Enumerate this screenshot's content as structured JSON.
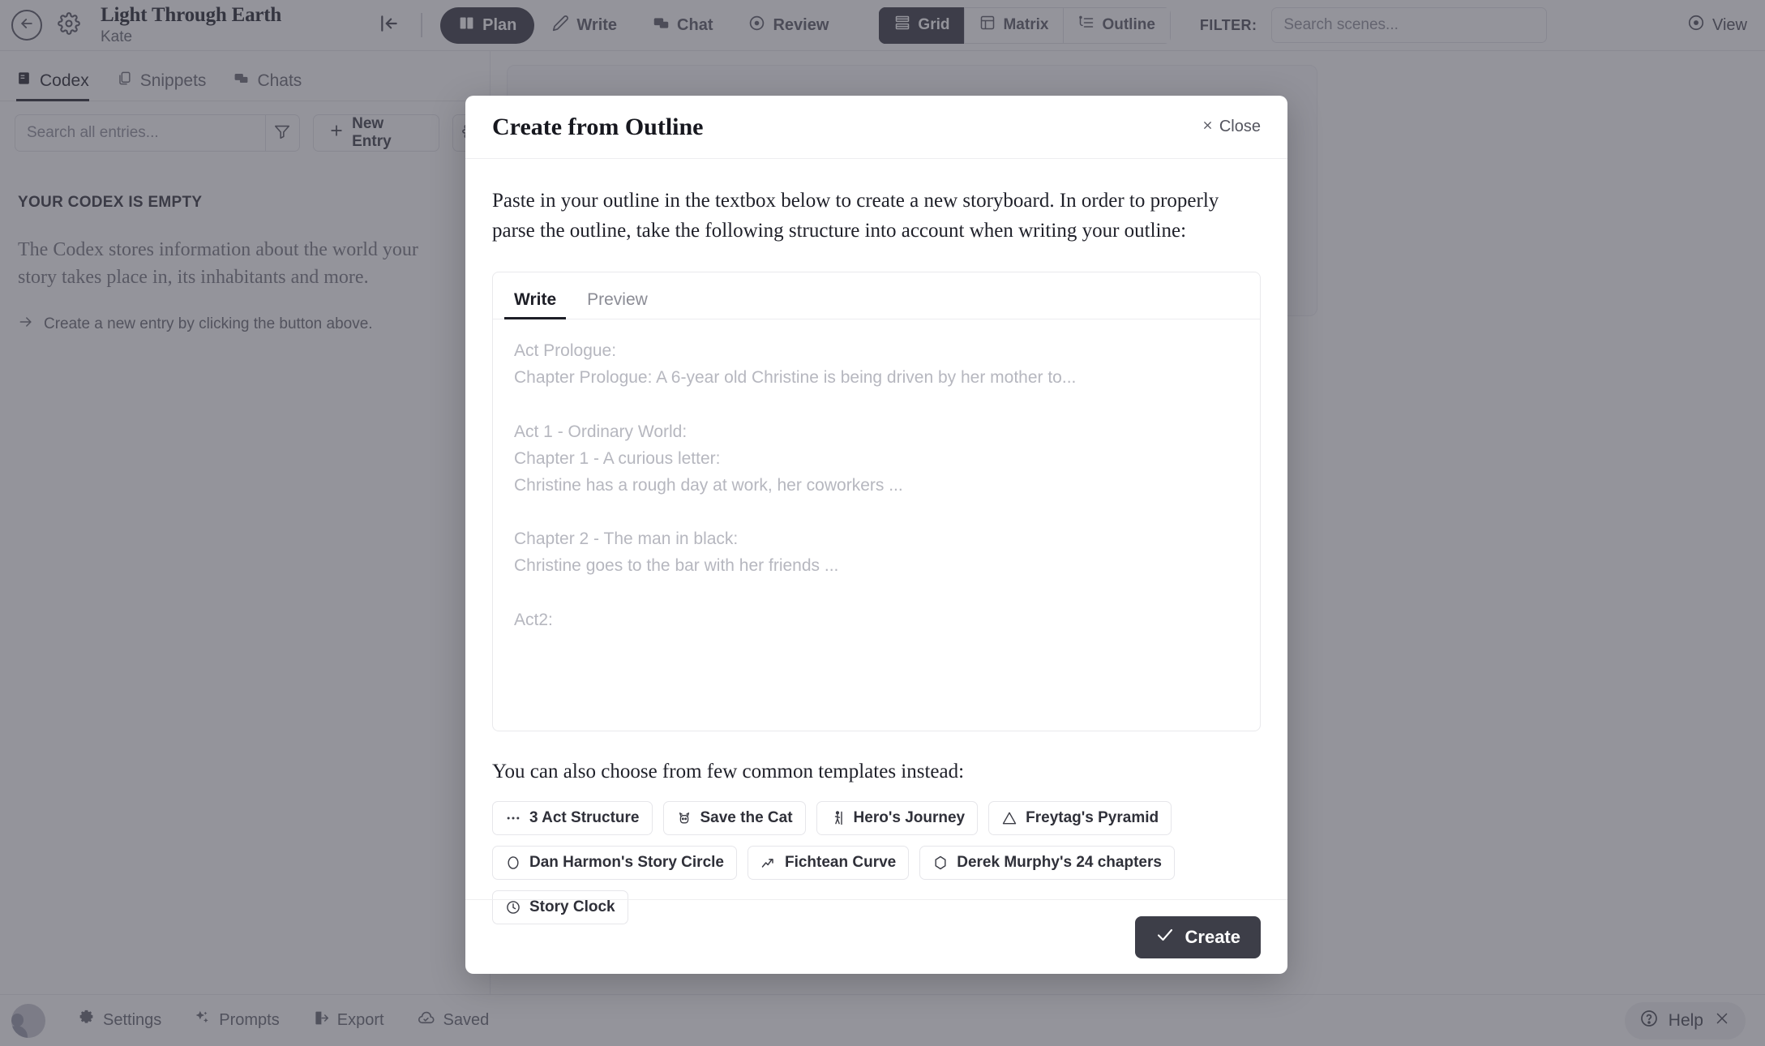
{
  "topbar": {
    "back_icon": "arrow-left-circle-icon",
    "settings_icon": "gear-icon",
    "project_title": "Light Through Earth",
    "project_author": "Kate",
    "collapse_icon": "collapse-left-icon",
    "modes": [
      {
        "label": "Plan",
        "icon": "book-open-icon",
        "active": true
      },
      {
        "label": "Write",
        "icon": "pencil-icon",
        "active": false
      },
      {
        "label": "Chat",
        "icon": "chat-bubbles-icon",
        "active": false
      },
      {
        "label": "Review",
        "icon": "eye-target-icon",
        "active": false
      }
    ],
    "views": [
      {
        "label": "Grid",
        "icon": "grid-icon",
        "active": true
      },
      {
        "label": "Matrix",
        "icon": "matrix-icon",
        "active": false
      },
      {
        "label": "Outline",
        "icon": "outline-list-icon",
        "active": false
      }
    ],
    "filter_label": "FILTER:",
    "scene_search_placeholder": "Search scenes...",
    "view_label": "View",
    "view_icon": "eye-target-icon"
  },
  "left_panel": {
    "tabs": [
      {
        "label": "Codex",
        "icon": "book-icon",
        "active": true
      },
      {
        "label": "Snippets",
        "icon": "copy-icon",
        "active": false
      },
      {
        "label": "Chats",
        "icon": "chat-bubbles-icon",
        "active": false
      }
    ],
    "search_placeholder": "Search all entries...",
    "filter_icon": "funnel-icon",
    "new_entry_label": "New Entry",
    "new_entry_icon": "plus-icon",
    "settings_icon": "gear-icon",
    "empty_title": "YOUR CODEX IS EMPTY",
    "empty_body": "The Codex stores information about the world your story takes place in, its inhabitants and more.",
    "empty_hint": "Create a new entry by clicking the button above.",
    "empty_hint_icon": "arrow-right-icon"
  },
  "modal": {
    "title": "Create from Outline",
    "close_label": "Close",
    "close_icon": "close-x-icon",
    "intro": "Paste in your outline in the textbox below to create a new storyboard. In order to properly parse the outline, take the following structure into account when writing your outline:",
    "editor_tabs": [
      {
        "label": "Write",
        "active": true
      },
      {
        "label": "Preview",
        "active": false
      }
    ],
    "textarea_value": "",
    "textarea_placeholder": "Act Prologue:\nChapter Prologue: A 6-year old Christine is being driven by her mother to...\n\nAct 1 - Ordinary World:\nChapter 1 - A curious letter:\nChristine has a rough day at work, her coworkers ...\n\nChapter 2 - The man in black:\nChristine goes to the bar with her friends ...\n\nAct2:",
    "templates_label": "You can also choose from few common templates instead:",
    "templates": [
      {
        "label": "3 Act Structure",
        "icon": "three-dots-icon"
      },
      {
        "label": "Save the Cat",
        "icon": "cat-icon"
      },
      {
        "label": "Hero's Journey",
        "icon": "hiker-icon"
      },
      {
        "label": "Freytag's Pyramid",
        "icon": "triangle-icon"
      },
      {
        "label": "Dan Harmon's Story Circle",
        "icon": "circle-icon"
      },
      {
        "label": "Fichtean Curve",
        "icon": "trend-up-icon"
      },
      {
        "label": "Derek Murphy's 24 chapters",
        "icon": "hexagon-icon"
      },
      {
        "label": "Story Clock",
        "icon": "clock-icon"
      }
    ],
    "create_label": "Create",
    "create_icon": "check-icon"
  },
  "bottombar": {
    "avatar": "user-avatar",
    "items": [
      {
        "label": "Settings",
        "icon": "gear-icon"
      },
      {
        "label": "Prompts",
        "icon": "sparkles-icon"
      },
      {
        "label": "Export",
        "icon": "file-export-icon"
      },
      {
        "label": "Saved",
        "icon": "cloud-check-icon"
      }
    ],
    "help_label": "Help",
    "help_icon": "question-circle-icon",
    "help_close_icon": "close-x-icon"
  },
  "colors": {
    "accent_dark": "#3d3e48",
    "overlay": "rgba(60,61,72,0.55)",
    "muted_text": "#8b8c95",
    "placeholder": "#b6b7bf"
  }
}
